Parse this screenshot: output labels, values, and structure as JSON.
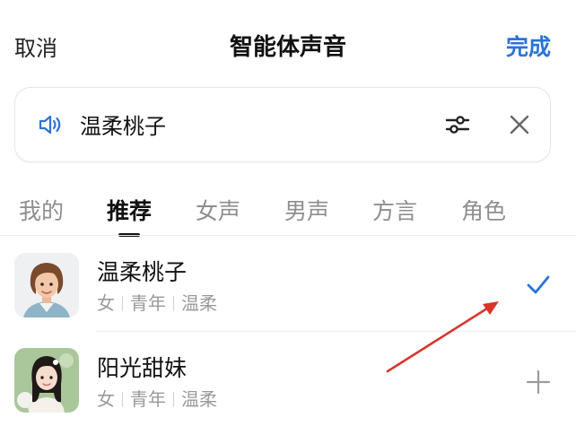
{
  "header": {
    "cancel_label": "取消",
    "title": "智能体声音",
    "done_label": "完成"
  },
  "current_voice": {
    "name": "温柔桃子",
    "icons": [
      "speaker-icon",
      "adjust-icon",
      "close-icon"
    ]
  },
  "tabs": [
    {
      "label": "我的",
      "active": false
    },
    {
      "label": "推荐",
      "active": true
    },
    {
      "label": "女声",
      "active": false
    },
    {
      "label": "男声",
      "active": false
    },
    {
      "label": "方言",
      "active": false
    },
    {
      "label": "角色",
      "active": false
    }
  ],
  "voices": [
    {
      "name": "温柔桃子",
      "tags": [
        "女",
        "青年",
        "温柔"
      ],
      "selected": true,
      "action_icon": "check-icon"
    },
    {
      "name": "阳光甜妹",
      "tags": [
        "女",
        "青年",
        "温柔"
      ],
      "selected": false,
      "action_icon": "plus-icon"
    }
  ],
  "colors": {
    "accent": "#2a74d8",
    "annotation_arrow": "#d9352b",
    "inactive_tab": "#8e8e8e"
  }
}
